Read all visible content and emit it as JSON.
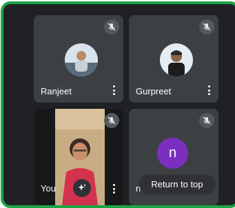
{
  "participants": [
    {
      "name": "Ranjeet",
      "muted_icon": "mic-off-icon"
    },
    {
      "name": "Gurpreet",
      "muted_icon": "mic-off-icon"
    },
    {
      "name": "You",
      "muted_icon": "mic-off-icon",
      "effects_icon": "sparkle-effects-icon"
    },
    {
      "name": "n",
      "initial": "n",
      "muted_icon": "mic-off-icon"
    }
  ],
  "return_to_top_label": "Return to top",
  "colors": {
    "frame_border": "#1ea446",
    "background": "#1f2124",
    "tile": "#3c4043",
    "avatar_initial_bg": "#7b2fbf"
  }
}
